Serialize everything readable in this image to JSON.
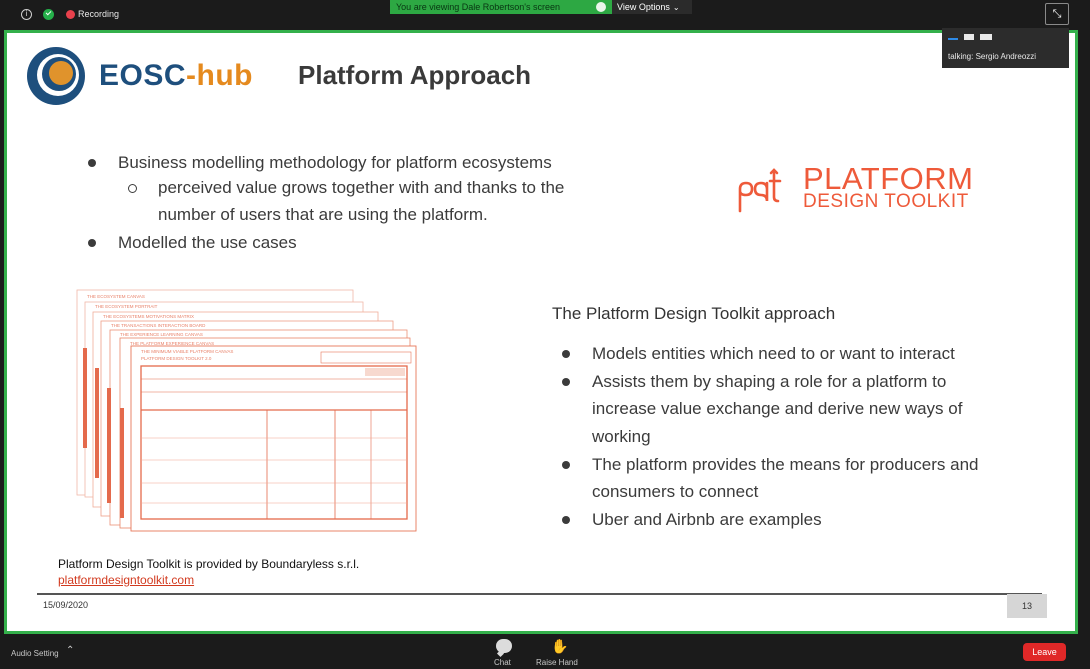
{
  "topbar": {
    "recording_label": "Recording",
    "viewing_text": "You are viewing Dale Robertson's screen",
    "view_options_label": "View Options",
    "exit_fullscreen_glyph": "⤡"
  },
  "slide": {
    "logo_text_left": "EOSC",
    "logo_text_dash": "-",
    "logo_text_right": "hub",
    "title": "Platform Approach",
    "bullets_top": [
      "Business modelling methodology for platform ecosystems",
      "Modelled the use cases"
    ],
    "sub_bullet_lines": [
      "perceived value grows together with and thanks to the",
      "number of users that are using the platform."
    ],
    "pdt_logo_title": "PLATFORM",
    "pdt_logo_subtitle": "DESIGN TOOLKIT",
    "approach_heading": "The Platform Design Toolkit approach",
    "approach_bullets": [
      [
        "Models entities which need to or want to interact"
      ],
      [
        "Assists them by shaping a role for a platform to",
        "increase value exchange and derive new ways of",
        "working"
      ],
      [
        "The platform provides the means for producers and",
        "consumers to connect"
      ],
      [
        "Uber and Airbnb are examples"
      ]
    ],
    "credit_text": "Platform Design Toolkit is provided by Boundaryless s.r.l.",
    "credit_link": "platformdesigntoolkit.com",
    "footer_date": "15/09/2020",
    "page_number": "13",
    "canvas_titles": [
      "THE ECOSYSTEM CANVAS",
      "THE ECOSYSTEM PORTRAIT",
      "THE ECOSYSTEMS MOTIVATIONS MATRIX",
      "THE TRANSACTIONS INTERACTION BOARD",
      "THE EXPERIENCE LEARNING CANVAS",
      "THE PLATFORM EXPERIENCE CANVAS",
      "THE MINIMUM VIABLE PLATFORM CANVAS",
      "PLATFORM DESIGN TOOLKIT 2.0"
    ]
  },
  "talking": {
    "label": "talking: Sergio Andreozzi"
  },
  "bottombar": {
    "audio_label": "Audio Setting",
    "chat_label": "Chat",
    "raise_hand_label": "Raise Hand",
    "leave_label": "Leave"
  },
  "colors": {
    "share_border": "#34b04b",
    "brand_blue": "#1e4f7d",
    "brand_orange": "#e58a1e",
    "pdt_red": "#ee5a3a",
    "leave_red": "#e02828"
  }
}
